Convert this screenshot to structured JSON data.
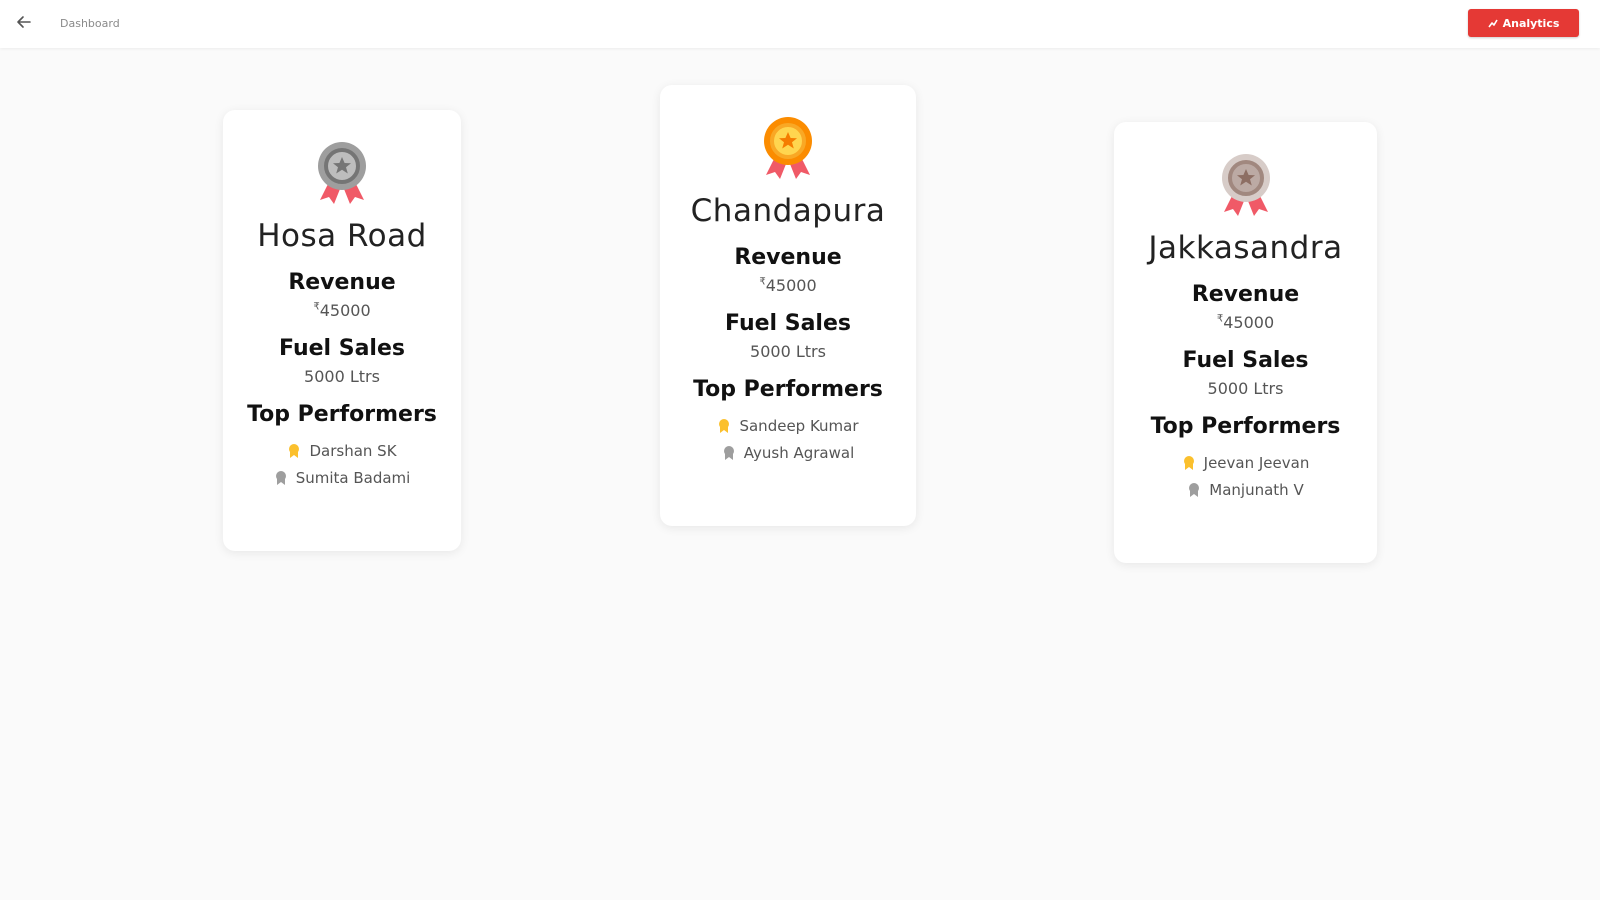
{
  "header": {
    "back_icon": "arrow-left-icon",
    "title": "Dashboard",
    "analytics_label": "Analytics",
    "analytics_icon": "chart-icon",
    "accent_color": "#e53935"
  },
  "labels": {
    "revenue": "Revenue",
    "fuel_sales": "Fuel Sales",
    "top_performers": "Top Performers",
    "currency_symbol": "₹"
  },
  "cards": [
    {
      "branch": "Hosa Road",
      "medal": "silver-medal-icon",
      "revenue": "45000",
      "fuel_sales": "5000 Ltrs",
      "performers": [
        {
          "name": "Darshan SK",
          "icon": "gold-ribbon-icon"
        },
        {
          "name": "Sumita Badami",
          "icon": "silver-ribbon-icon"
        }
      ]
    },
    {
      "branch": "Chandapura",
      "medal": "gold-medal-icon",
      "revenue": "45000",
      "fuel_sales": "5000 Ltrs",
      "performers": [
        {
          "name": "Sandeep Kumar",
          "icon": "gold-ribbon-icon"
        },
        {
          "name": "Ayush Agrawal",
          "icon": "silver-ribbon-icon"
        }
      ]
    },
    {
      "branch": "Jakkasandra",
      "medal": "bronze-medal-icon",
      "revenue": "45000",
      "fuel_sales": "5000 Ltrs",
      "performers": [
        {
          "name": "Jeevan Jeevan",
          "icon": "gold-ribbon-icon"
        },
        {
          "name": "Manjunath V",
          "icon": "silver-ribbon-icon"
        }
      ]
    }
  ]
}
